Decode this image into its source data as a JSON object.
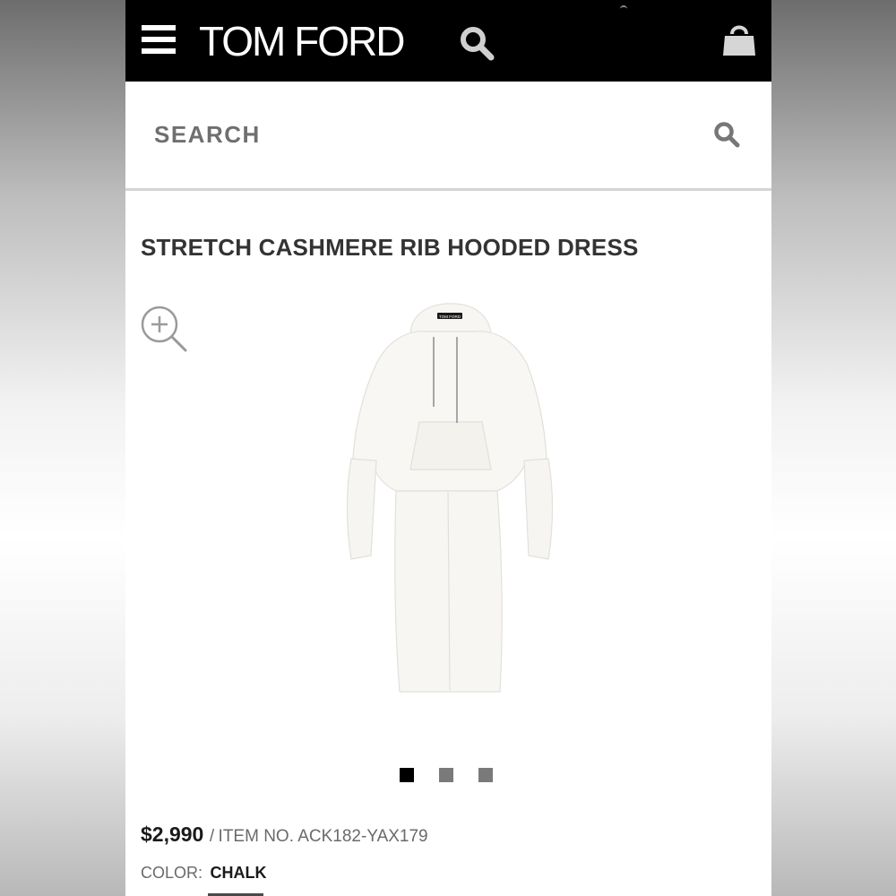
{
  "header": {
    "brand": "TOM FORD",
    "menu_icon": "hamburger-menu-icon",
    "search_icon": "search-icon",
    "bag_icon": "shopping-bag-icon",
    "background_color": "#000000"
  },
  "search": {
    "placeholder": "SEARCH",
    "icon": "search-icon"
  },
  "product": {
    "title": "STRETCH CASHMERE RIB HOODED DRESS",
    "zoom_icon": "zoom-in-icon",
    "image_label": "TOM FORD",
    "price": "$2,990",
    "separator": "/",
    "item_number": "ITEM NO. ACK182-YAX179",
    "color_label": "COLOR:",
    "color_value": "CHALK"
  },
  "carousel": {
    "total": 3,
    "active_index": 0,
    "active_color": "#000000",
    "inactive_color": "#7a7a7a"
  }
}
